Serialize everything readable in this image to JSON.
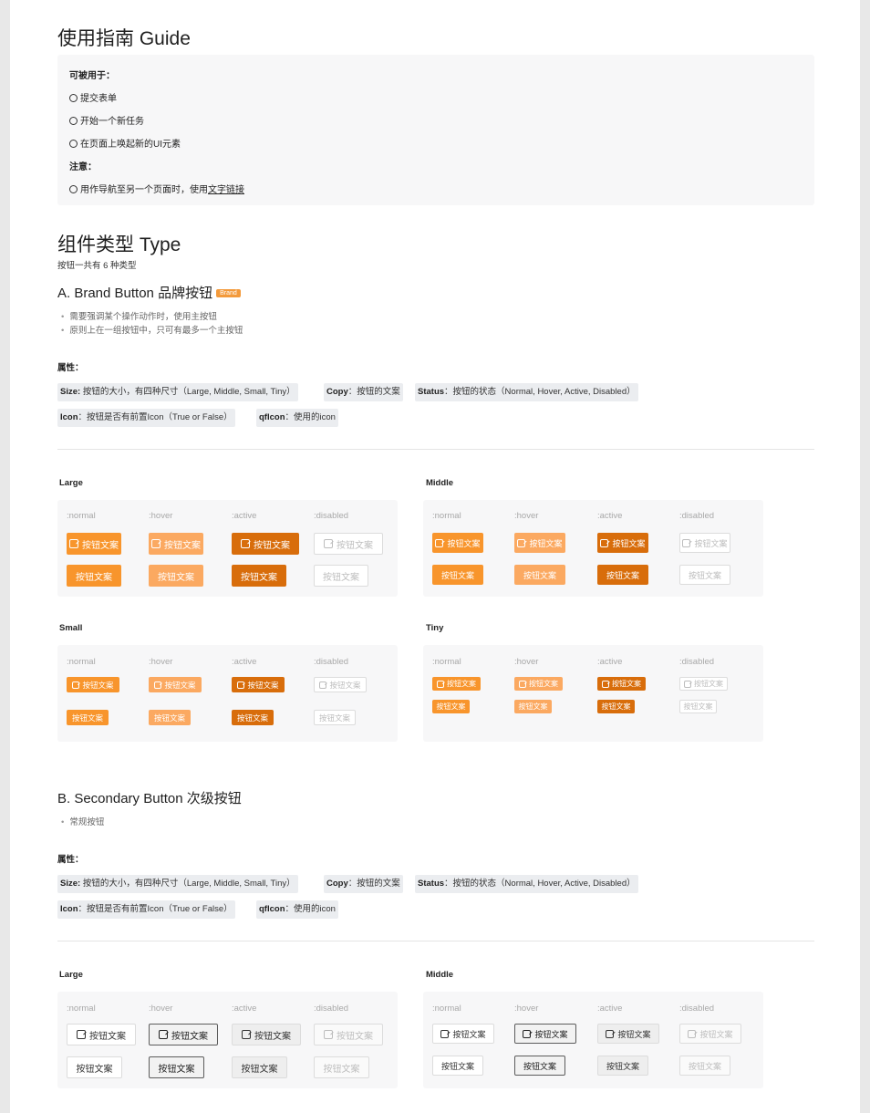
{
  "guide": {
    "title": "使用指南 Guide",
    "usable_for": "可被用于：",
    "items": [
      "提交表单",
      "开始一个新任务",
      "在页面上唤起新的UI元素"
    ],
    "note": "注意：",
    "note_text": "用作导航至另一个页面时，使用",
    "note_link": "文字链接"
  },
  "type": {
    "title": "组件类型 Type",
    "subtitle": "按钮一共有 6 种类型"
  },
  "brand": {
    "title": "A. Brand Button 品牌按钮",
    "badge": "Brand",
    "bullets": [
      "需要强调某个操作动作时，使用主按钮",
      "原则上在一组按钮中，只可有最多一个主按钮"
    ],
    "attr_label": "属性：",
    "tags": [
      {
        "key": "Size:",
        "text": " 按钮的大小，有四种尺寸（Large, Middle, Small, Tiny）"
      },
      {
        "key": "Copy",
        "text": "：按钮的文案"
      },
      {
        "key": "Status",
        "text": "：按钮的状态（Normal, Hover, Active, Disabled）"
      },
      {
        "key": "Icon",
        "text": "：按钮是否有前置Icon（True or False）"
      },
      {
        "key": "qfIcon",
        "text": "：使用的icon"
      }
    ]
  },
  "secondary": {
    "title": "B. Secondary Button 次级按钮",
    "bullets": [
      "常规按钮"
    ],
    "attr_label": "属性：",
    "tags": [
      {
        "key": "Size:",
        "text": " 按钮的大小，有四种尺寸（Large, Middle, Small, Tiny）"
      },
      {
        "key": "Copy",
        "text": "：按钮的文案"
      },
      {
        "key": "Status",
        "text": "：按钮的状态（Normal, Hover, Active, Disabled）"
      },
      {
        "key": "Icon",
        "text": "：按钮是否有前置Icon（True or False）"
      },
      {
        "key": "qfIcon",
        "text": "：使用的icon"
      }
    ]
  },
  "sizes": {
    "large": "Large",
    "middle": "Middle",
    "small": "Small",
    "tiny": "Tiny"
  },
  "states": [
    ":normal",
    ":hover",
    ":active",
    ":disabled"
  ],
  "button_label": "按钮文案",
  "icons": {
    "button_icon": "edit-icon"
  },
  "colors": {
    "brand_normal": "#f8952c",
    "brand_hover": "#fba961",
    "brand_active": "#d86d0b",
    "secondary_hover_border": "#5c5c5c"
  }
}
